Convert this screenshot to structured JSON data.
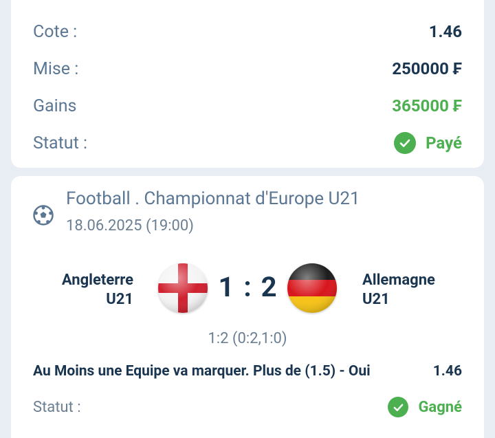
{
  "summary": {
    "odds_label": "Cote :",
    "odds_value": "1.46",
    "stake_label": "Mise :",
    "stake_value": "250000 ₣",
    "winnings_label": "Gains",
    "winnings_value": "365000 ₣",
    "status_label": "Statut :",
    "status_value": "Payé"
  },
  "event": {
    "sport_icon": "soccer-ball-icon",
    "title": "Football . Championnat d'Europe U21",
    "date": "18.06.2025 (19:00)",
    "home_team_line1": "Angleterre",
    "home_team_line2": "U21",
    "away_team_line1": "Allemagne",
    "away_team_line2": "U21",
    "home_flag": "england-flag-icon",
    "away_flag": "germany-flag-icon",
    "score": "1 : 2",
    "score_detail": "1:2 (0:2,1:0)",
    "bet_description": "Au Moins une Equipe va marquer. Plus de (1.5) - Oui",
    "bet_odds": "1.46",
    "status_label": "Statut :",
    "status_value": "Gagné"
  },
  "colors": {
    "label": "#5b7794",
    "value": "#1a3550",
    "success": "#4caf50",
    "background": "#e9eef4",
    "card": "#ffffff"
  }
}
